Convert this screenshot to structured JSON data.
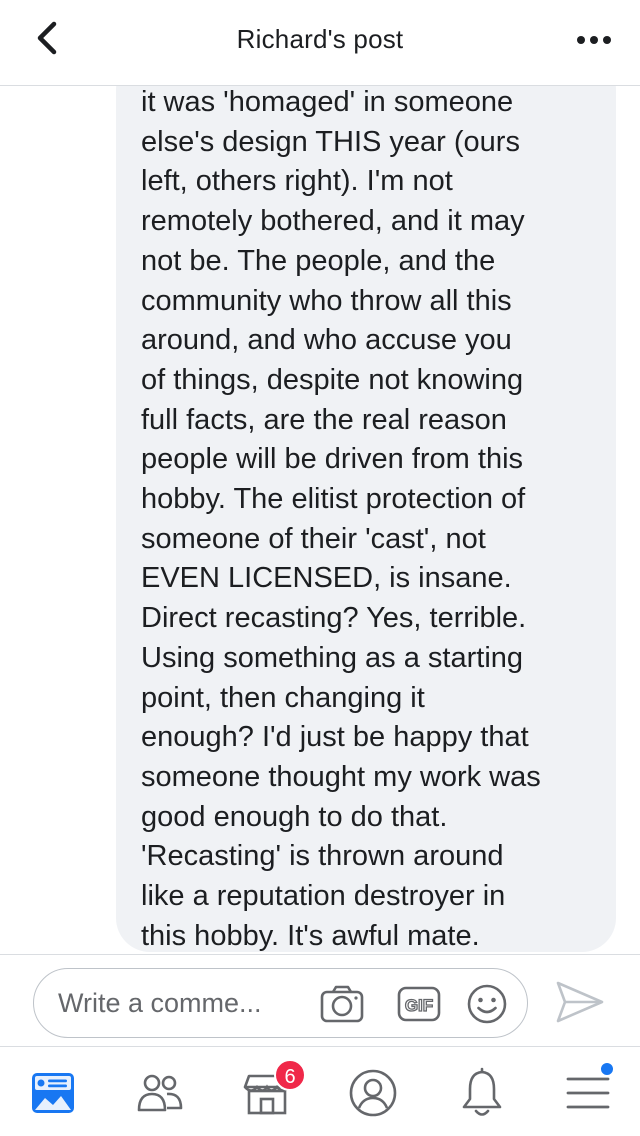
{
  "header": {
    "title": "Richard's post"
  },
  "comment": {
    "text": "it was 'homaged' in someone\nelse's design THIS year (ours\nleft, others right). I'm not\nremotely bothered, and it may\nnot be. The people, and the\ncommunity who throw all this\naround, and who accuse you\nof things, despite not knowing\nfull facts, are the real reason\npeople will be driven from this\nhobby. The elitist protection of\nsomeone of their 'cast', not\nEVEN LICENSED, is insane.\nDirect recasting? Yes, terrible.\nUsing something as a starting\npoint, then changing it\nenough? I'd just be happy that\nsomeone thought my work was\ngood enough to do that.\n'Recasting' is thrown around\nlike a reputation destroyer in\nthis hobby. It's awful mate."
  },
  "composer": {
    "placeholder": "Write a comme...",
    "icons": [
      "camera-icon",
      "gif-icon",
      "emoji-icon",
      "send-icon"
    ],
    "gif_label": "GIF"
  },
  "tabbar": {
    "tabs": [
      "news-feed",
      "friends",
      "marketplace",
      "profile",
      "notifications",
      "menu"
    ],
    "marketplace_badge": "6",
    "colors": {
      "active": "#1877f2",
      "inactive": "#65676b",
      "badge": "#f02849"
    }
  }
}
